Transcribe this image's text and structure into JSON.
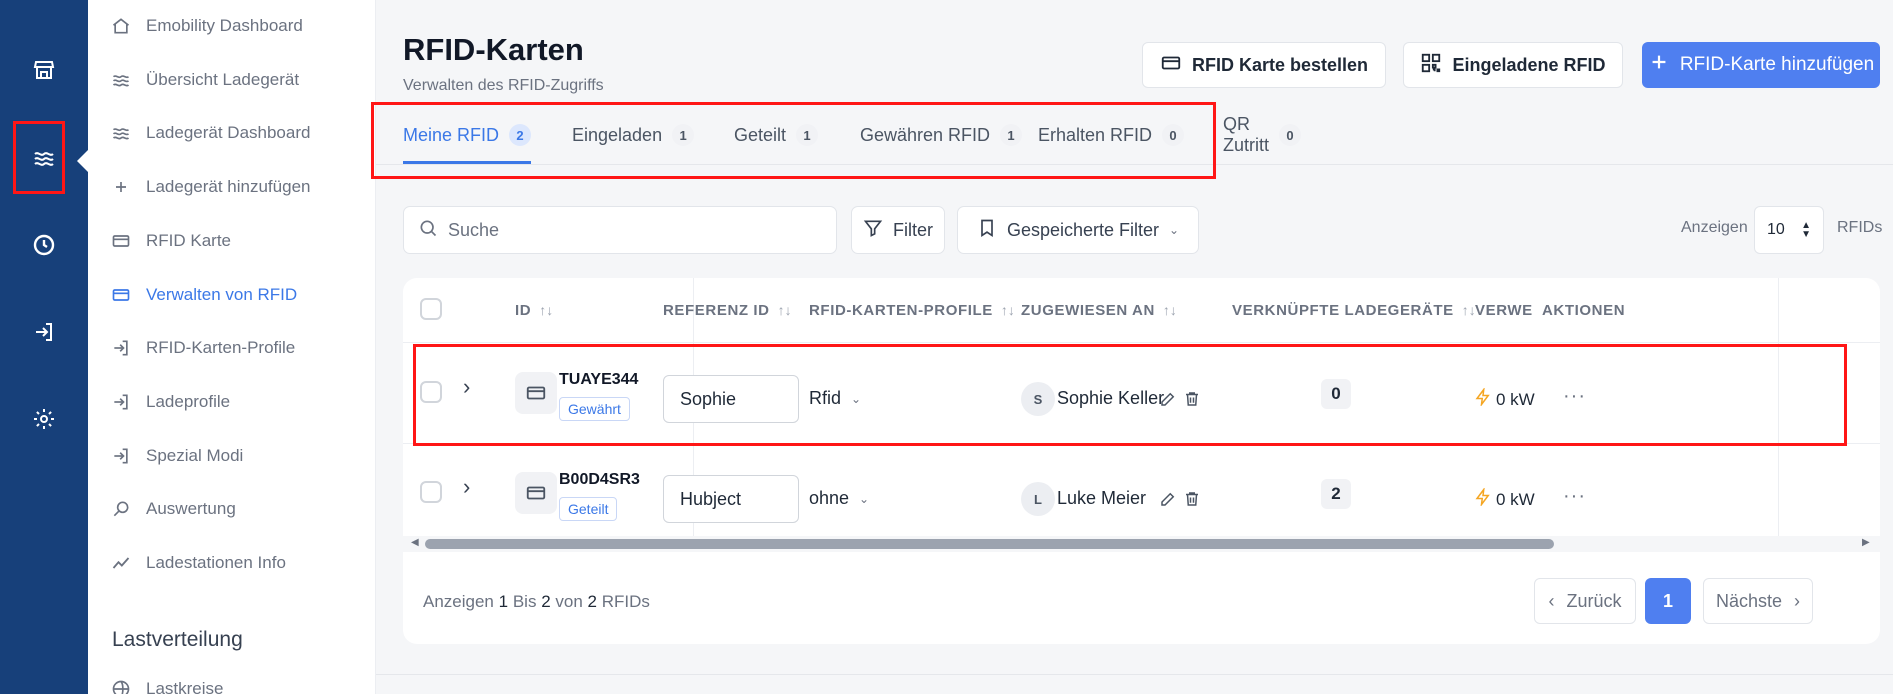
{
  "rail": {
    "icons": [
      "store-icon",
      "waves-icon",
      "clock-icon",
      "login-icon",
      "gear-icon"
    ]
  },
  "sidebar": {
    "items": [
      {
        "label": "Emobility Dashboard",
        "icon": "home-icon"
      },
      {
        "label": "Übersicht Ladegerät",
        "icon": "waves-icon"
      },
      {
        "label": "Ladegerät Dashboard",
        "icon": "waves-icon"
      },
      {
        "label": "Ladegerät hinzufügen",
        "icon": "plus-icon"
      },
      {
        "label": "RFID Karte",
        "icon": "card-icon"
      },
      {
        "label": "Verwalten von RFID",
        "icon": "card-icon"
      },
      {
        "label": "RFID-Karten-Profile",
        "icon": "login-icon"
      },
      {
        "label": "Ladeprofile",
        "icon": "login-icon"
      },
      {
        "label": "Spezial Modi",
        "icon": "login-icon"
      },
      {
        "label": "Auswertung",
        "icon": "search-icon"
      },
      {
        "label": "Ladestationen Info",
        "icon": "trend-icon"
      },
      {
        "label": "Lastkreise",
        "icon": "globe-icon"
      }
    ],
    "section_title": "Lastverteilung",
    "active_index": 5
  },
  "header": {
    "title": "RFID-Karten",
    "subtitle": "Verwalten des RFID-Zugriffs",
    "order_button": "RFID Karte bestellen",
    "invited_button": "Eingeladene RFID",
    "add_button": "RFID-Karte hinzufügen"
  },
  "tabs": [
    {
      "label": "Meine RFID",
      "count": "2"
    },
    {
      "label": "Eingeladen",
      "count": "1"
    },
    {
      "label": "Geteilt",
      "count": "1"
    },
    {
      "label": "Gewähren RFID",
      "count": "1"
    },
    {
      "label": "Erhalten RFID",
      "count": "0"
    },
    {
      "label": "QR Zutritt",
      "count": "0"
    }
  ],
  "toolbar": {
    "search_placeholder": "Suche",
    "filter_label": "Filter",
    "saved_filter_label": "Gespeicherte Filter",
    "show_label": "Anzeigen",
    "page_size": "10",
    "unit_label": "RFIDs"
  },
  "table": {
    "headers": {
      "id": "ID",
      "reference": "REFERENZ ID",
      "profiles": "RFID-KARTEN-PROFILE",
      "assigned": "ZUGEWIESEN AN",
      "linked": "VERKNÜPFTE LADEGERÄTE",
      "usage": "VERWE",
      "actions": "AKTIONEN"
    },
    "rows": [
      {
        "id": "TUAYE344",
        "status": "Gewährt",
        "reference": "Sophie",
        "profile": "Rfid",
        "avatar": "S",
        "assignee": "Sophie Keller",
        "linked": "0",
        "usage": "0 kW"
      },
      {
        "id": "B00D4SR3",
        "status": "Geteilt",
        "reference": "Hubject",
        "profile": "ohne",
        "avatar": "L",
        "assignee": "Luke Meier",
        "linked": "2",
        "usage": "0 kW"
      }
    ]
  },
  "footer": {
    "prefix": "Anzeigen",
    "from": "1",
    "between": "Bis",
    "to": "2",
    "of": "von",
    "total": "2",
    "unit": "RFIDs",
    "prev": "Zurück",
    "current_page": "1",
    "next": "Nächste"
  },
  "colors": {
    "rail": "#17407a",
    "accent": "#3b78e7",
    "primary_button": "#4f7ff0",
    "highlight": "#ff1616",
    "usage_icon": "#f5a623"
  }
}
